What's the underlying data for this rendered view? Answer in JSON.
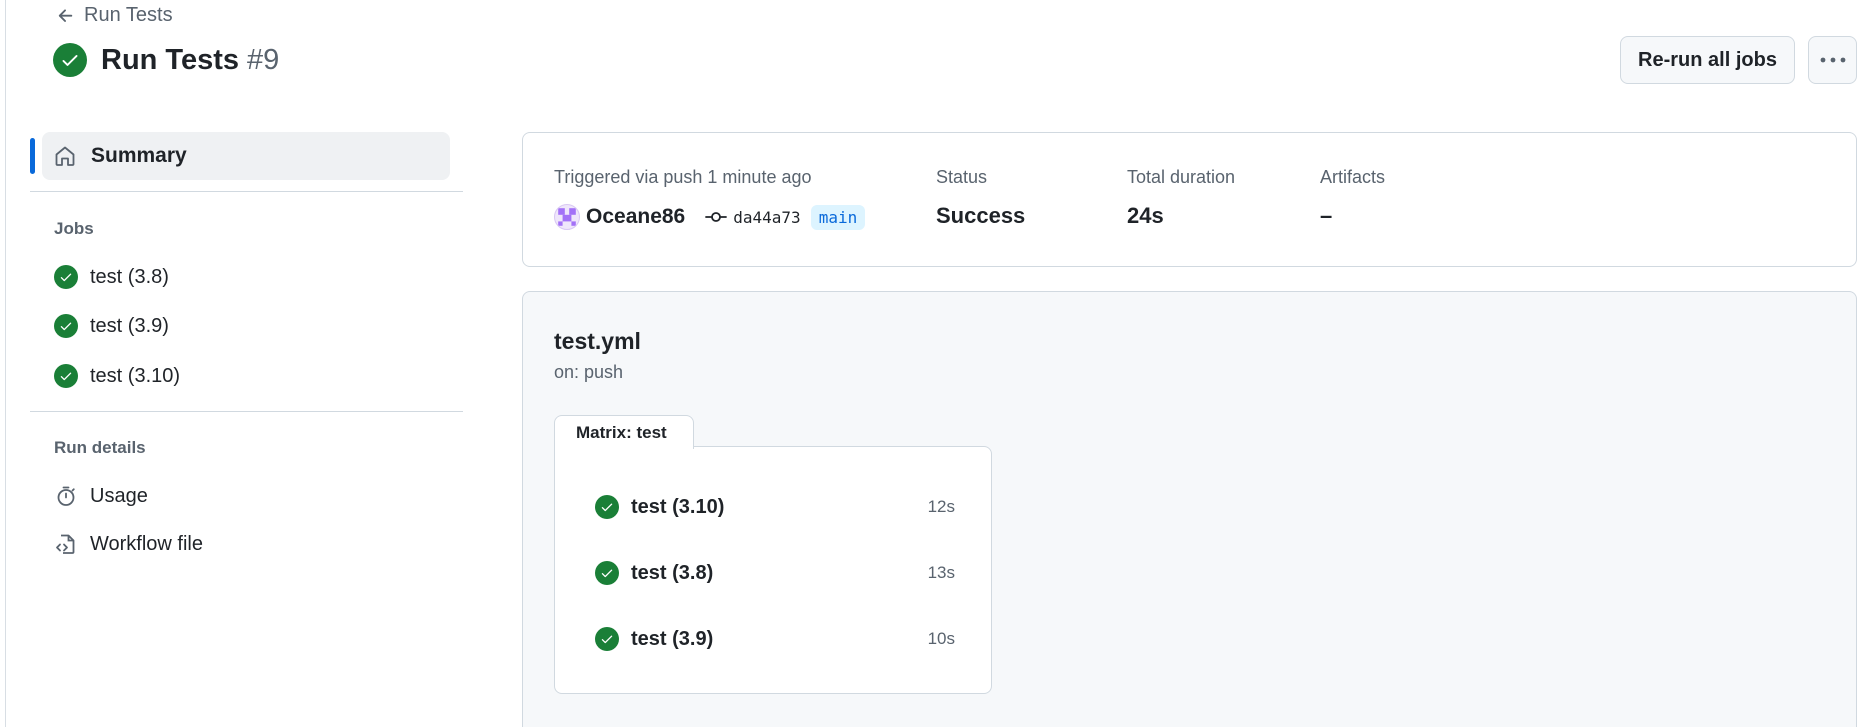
{
  "header": {
    "back_label": "Run Tests",
    "run_title": "Run Tests",
    "run_number": "#9",
    "rerun_label": "Re-run all jobs"
  },
  "sidebar": {
    "summary_label": "Summary",
    "jobs_heading": "Jobs",
    "jobs": [
      {
        "label": "test (3.8)"
      },
      {
        "label": "test (3.9)"
      },
      {
        "label": "test (3.10)"
      }
    ],
    "run_details_heading": "Run details",
    "usage_label": "Usage",
    "workflow_file_label": "Workflow file"
  },
  "summary": {
    "triggered_label": "Triggered via push 1 minute ago",
    "actor": "Oceane86",
    "commit": "da44a73",
    "branch": "main",
    "status_label": "Status",
    "status_value": "Success",
    "duration_label": "Total duration",
    "duration_value": "24s",
    "artifacts_label": "Artifacts",
    "artifacts_value": "–"
  },
  "workflow": {
    "file": "test.yml",
    "trigger": "on: push",
    "matrix_label": "Matrix: test",
    "jobs": [
      {
        "label": "test (3.10)",
        "duration": "12s"
      },
      {
        "label": "test (3.8)",
        "duration": "13s"
      },
      {
        "label": "test (3.9)",
        "duration": "10s"
      }
    ]
  },
  "colors": {
    "success": "#1a7f37",
    "accent": "#0969da",
    "muted_text": "#59636e"
  }
}
